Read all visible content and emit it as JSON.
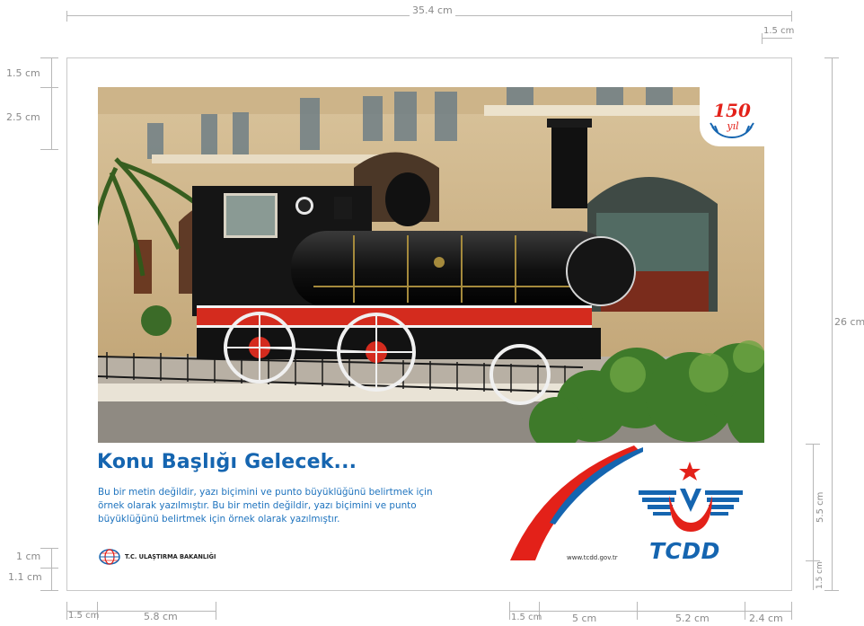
{
  "dimensions": {
    "top_width": "35.4 cm",
    "top_right_margin": "1.5 cm",
    "left_top_margin": "1.5 cm",
    "left_badge": "2.5 cm",
    "left_bottom_1": "1 cm",
    "left_bottom_2": "1.1 cm",
    "right_height": "26 cm",
    "right_logo_block": "5.5 cm",
    "right_bottom_margin": "1.5 cm",
    "bottom_left_margin": "1.5 cm",
    "bottom_ministry": "5.8 cm",
    "bottom_swoosh_margin": "1.5 cm",
    "bottom_swoosh": "5 cm",
    "bottom_logo": "5.2 cm",
    "bottom_right_margin": "2.4 cm"
  },
  "badge": {
    "number": "150",
    "label": "yıl"
  },
  "headline": "Konu Başlığı Gelecek...",
  "body": "Bu bir metin değildir, yazı biçimini ve punto büyüklüğünü belirtmek için örnek olarak yazılmıştır. Bu bir metin değildir,  yazı biçimini ve punto büyüklüğünü belirtmek için örnek olarak yazılmıştır.",
  "ministry": {
    "name": "T.C. ULAŞTIRMA BAKANLIĞI"
  },
  "url": "www.tcdd.gov.tr",
  "brand": {
    "name": "TCDD",
    "blue": "#1565b0",
    "red": "#e32119"
  }
}
